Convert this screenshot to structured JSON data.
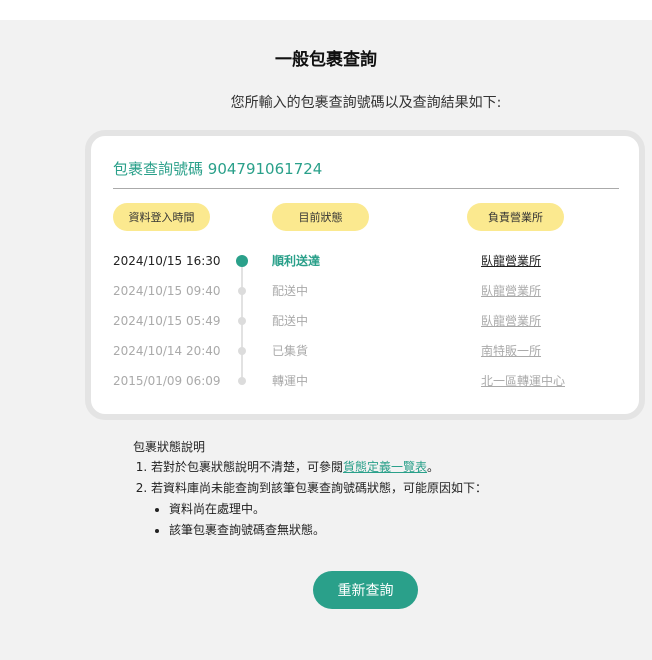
{
  "header": {
    "title": "一般包裹查詢",
    "subtitle": "您所輸入的包裹查詢號碼以及查詢結果如下:"
  },
  "card": {
    "tracking_label": "包裹查詢號碼",
    "tracking_number": "904791061724",
    "columns": [
      "資料登入時間",
      "目前狀態",
      "負責營業所"
    ],
    "rows": [
      {
        "time": "2024/10/15 16:30",
        "status": "順利送達",
        "office": "臥龍營業所"
      },
      {
        "time": "2024/10/15 09:40",
        "status": "配送中",
        "office": "臥龍營業所"
      },
      {
        "time": "2024/10/15 05:49",
        "status": "配送中",
        "office": "臥龍營業所"
      },
      {
        "time": "2024/10/14 20:40",
        "status": "已集貨",
        "office": "南特販一所"
      },
      {
        "time": "2015/01/09 06:09",
        "status": "轉運中",
        "office": "北一區轉運中心"
      }
    ]
  },
  "notes": {
    "title": "包裹狀態說明",
    "item1_prefix": "若對於包裹狀態說明不清楚，可參閱",
    "item1_link": "貨態定義一覽表",
    "item1_suffix": "。",
    "item2": "若資料庫尚未能查詢到該筆包裹查詢號碼狀態，可能原因如下：",
    "reasons": [
      "資料尚在處理中。",
      "該筆包裹查詢號碼查無狀態。"
    ]
  },
  "actions": {
    "requery_label": "重新查詢"
  },
  "colors": {
    "accent": "#2aa08a",
    "pill": "#fbe98f"
  }
}
